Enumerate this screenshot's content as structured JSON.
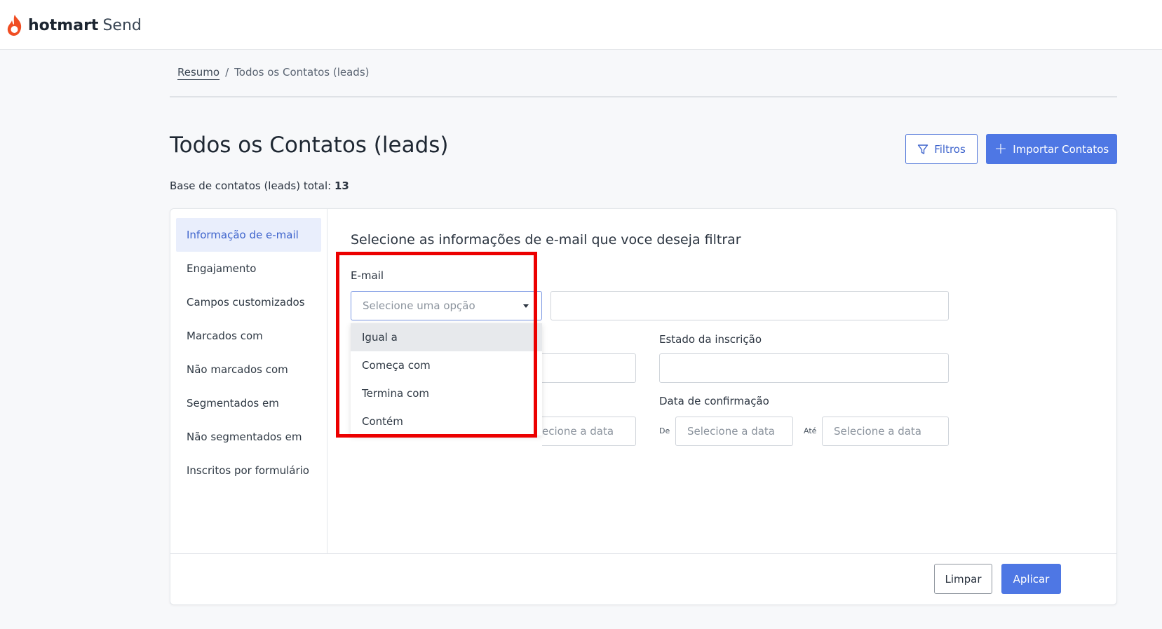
{
  "brand": {
    "name_bold": "hotmart",
    "name_suffix": "Send",
    "icon": "flame-icon",
    "accent": "#f04e23"
  },
  "breadcrumb": {
    "home": "Resumo",
    "separator": "/",
    "current": "Todos os Contatos (leads)"
  },
  "page": {
    "title": "Todos os Contatos (leads)",
    "total_label": "Base de contatos (leads) total:",
    "total_value": "13"
  },
  "actions": {
    "filters": "Filtros",
    "import": "Importar Contatos",
    "primary_color": "#4e77e4"
  },
  "sidebar": {
    "items": [
      {
        "label": "Informação de e-mail",
        "active": true
      },
      {
        "label": "Engajamento"
      },
      {
        "label": "Campos customizados"
      },
      {
        "label": "Marcados com"
      },
      {
        "label": "Não marcados com"
      },
      {
        "label": "Segmentados em"
      },
      {
        "label": "Não segmentados em"
      },
      {
        "label": "Inscritos por formulário"
      }
    ]
  },
  "content": {
    "heading": "Selecione as informações de e-mail que voce deseja filtrar",
    "email_label": "E-mail",
    "select_placeholder": "Selecione uma opção",
    "dropdown_options": [
      "Igual a",
      "Começa com",
      "Termina com",
      "Contém"
    ],
    "subscription_state_label": "Estado da inscrição",
    "confirmation_date_label": "Data de confirmação",
    "date_placeholder": "Selecione a data",
    "date_placeholder_partial": "ecione a data",
    "from_label": "De",
    "to_label": "Até"
  },
  "footer": {
    "clear": "Limpar",
    "apply": "Aplicar"
  },
  "annotation": {
    "highlight_color": "#ec0000"
  }
}
